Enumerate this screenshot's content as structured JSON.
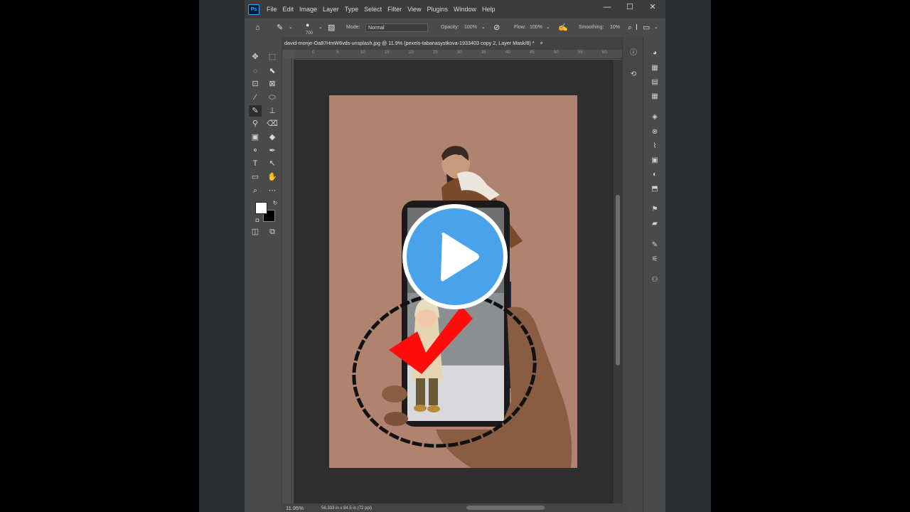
{
  "app": {
    "logo": "Ps",
    "menus": [
      "File",
      "Edit",
      "Image",
      "Layer",
      "Type",
      "Select",
      "Filter",
      "View",
      "Plugins",
      "Window",
      "Help"
    ],
    "window_controls": {
      "minimize": "—",
      "maximize": "☐",
      "close": "✕"
    }
  },
  "options": {
    "brush_size": "700",
    "mode_label": "Mode:",
    "mode_value": "Normal",
    "opacity_label": "Opacity:",
    "opacity_value": "100%",
    "flow_label": "Flow:",
    "flow_value": "100%",
    "smoothing_label": "Smoothing:",
    "smoothing_value": "10%"
  },
  "document": {
    "tab_title": "david-monje-Oa87HmW6vds-unsplash.jpg @ 11.9% (pexels-tabanasystkova-1933403 copy 2, Layer Mask/8) *",
    "tab_close": "×"
  },
  "rulers": {
    "top": [
      "0",
      "5",
      "10",
      "15",
      "20",
      "25",
      "30",
      "35",
      "40",
      "45",
      "50",
      "55",
      "60"
    ]
  },
  "status": {
    "zoom": "11.95%",
    "doc_size": "56.333 in x 84.5 in (72 ppi)"
  },
  "colors": {
    "canvas_bg": "#b08370",
    "play_button": "#4aa3ea",
    "checkmark": "#ff0d0d"
  }
}
